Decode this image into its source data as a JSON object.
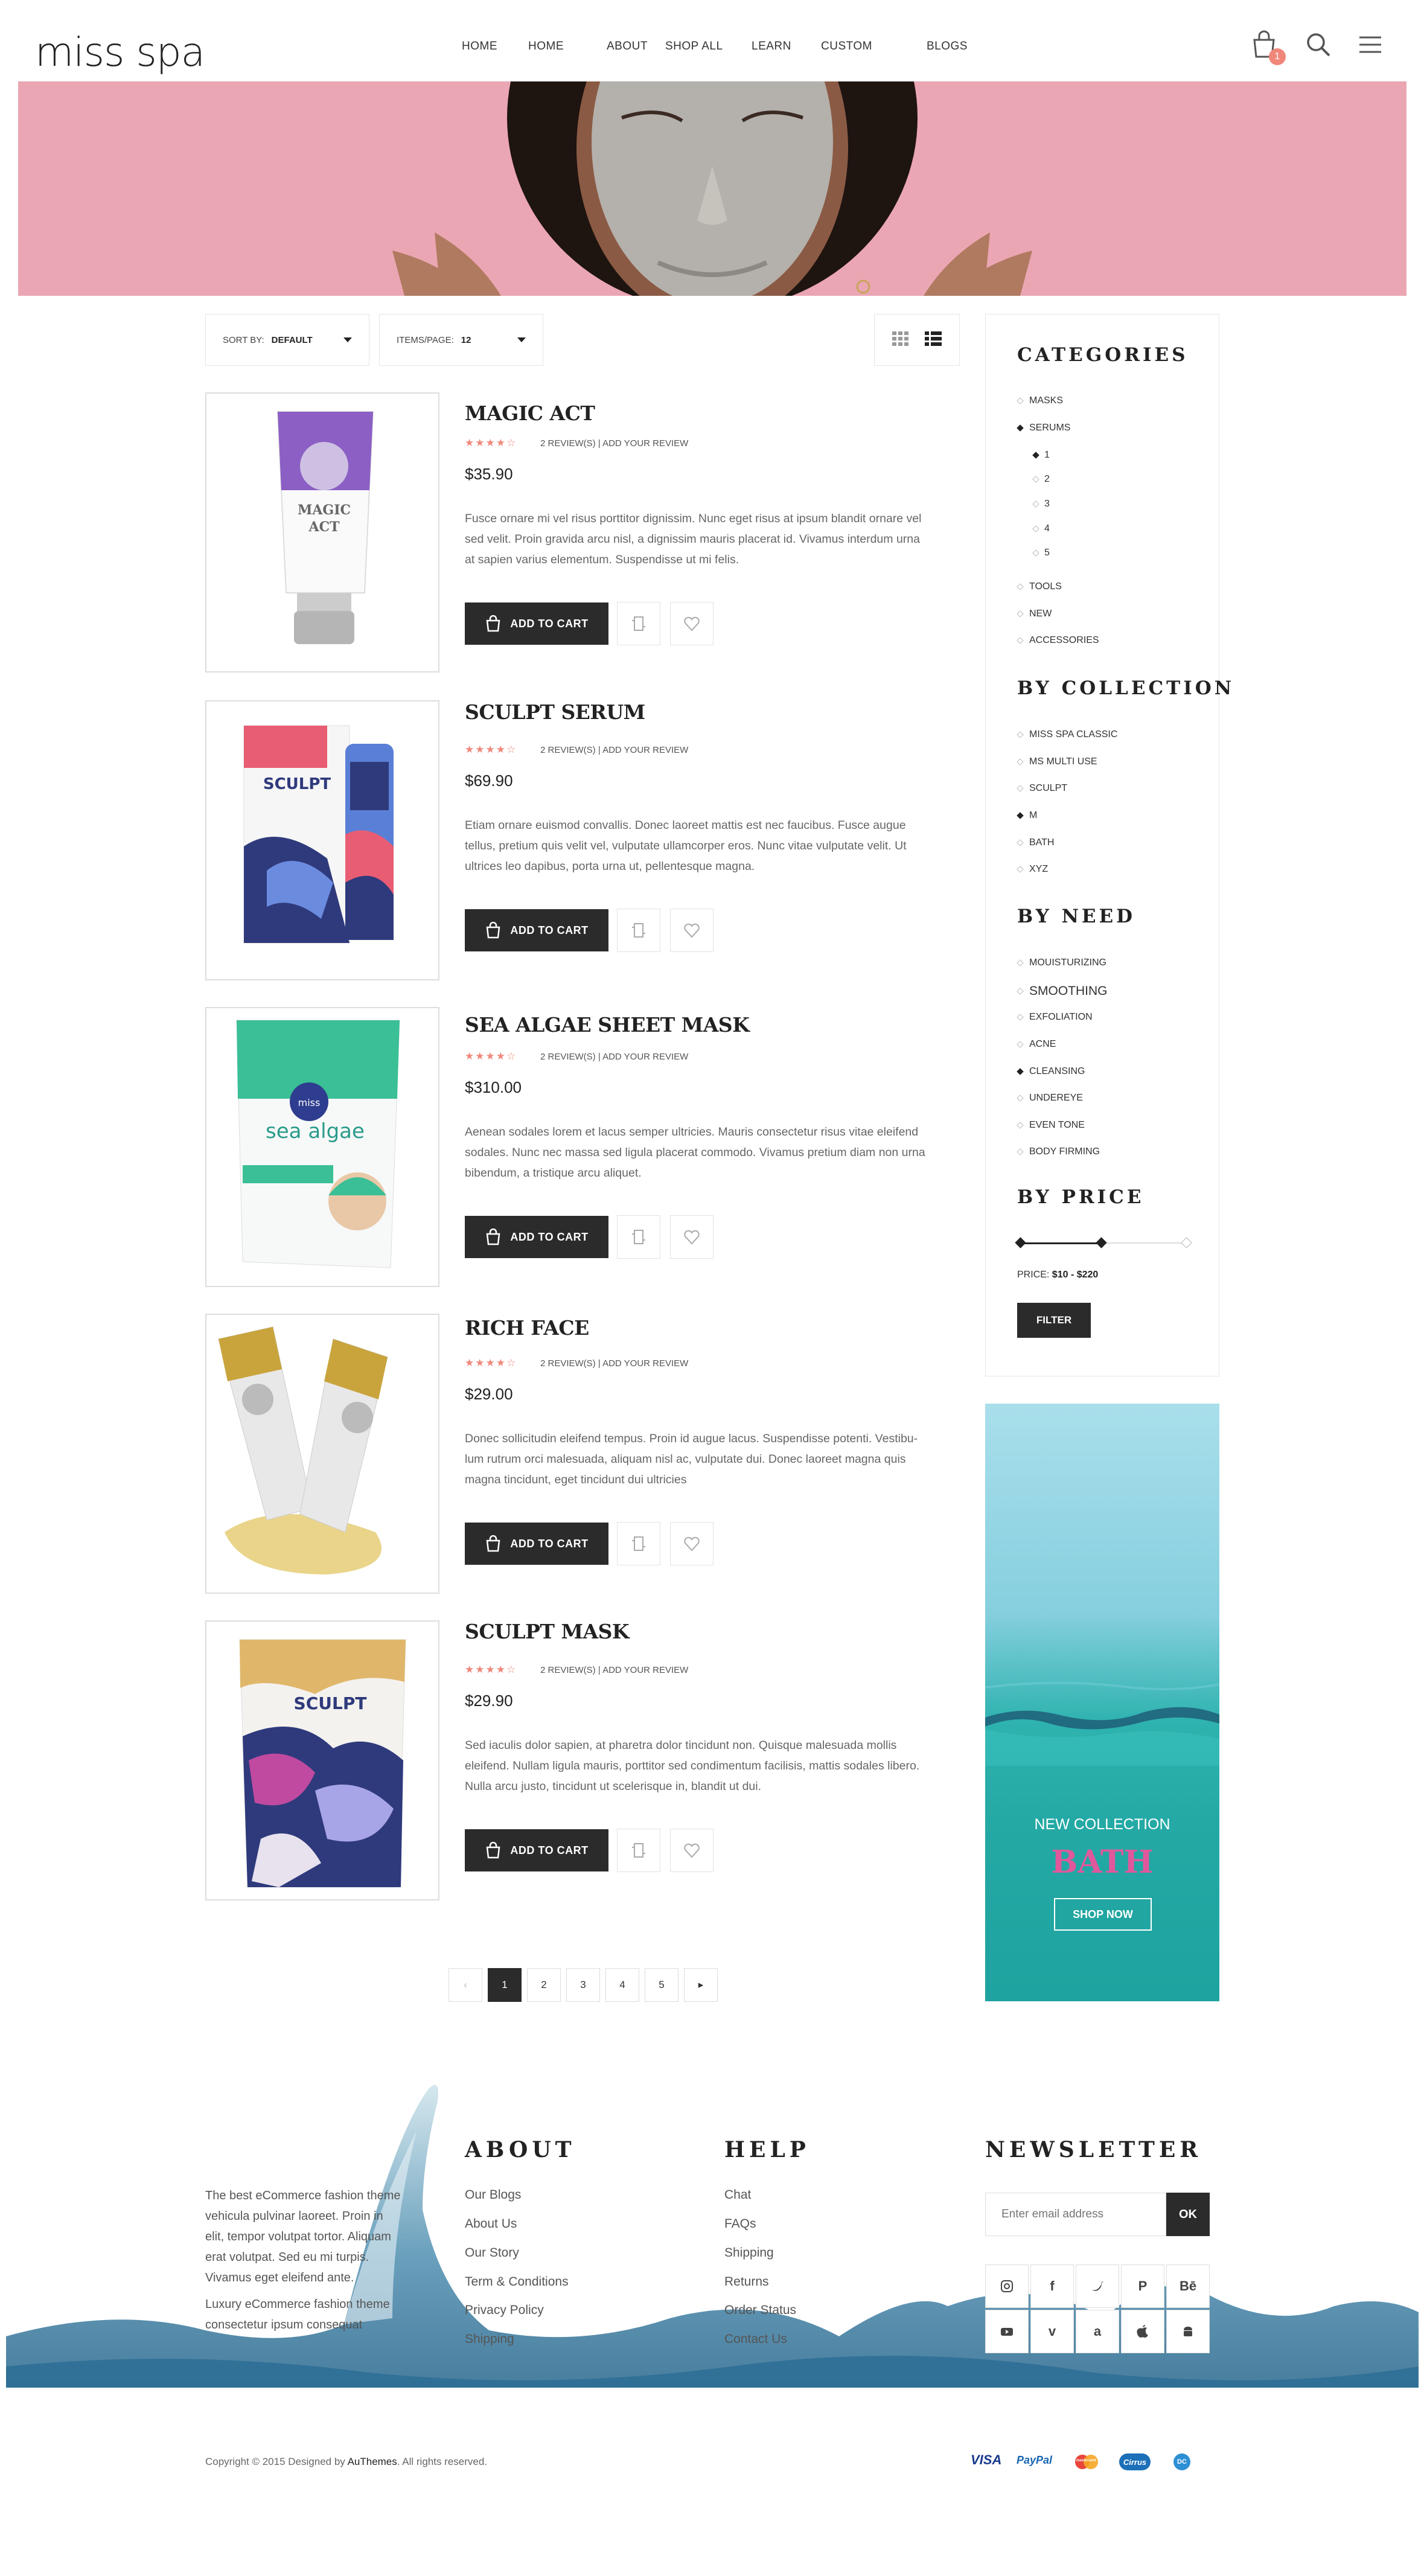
{
  "header": {
    "logo": "miss spa",
    "nav": [
      "HOME",
      "HOME",
      "ABOUT",
      "SHOP ALL",
      "LEARN",
      "CUSTOM",
      "BLOGS"
    ],
    "cart_count": "1"
  },
  "toolbar": {
    "sort_label": "SORT BY:",
    "sort_value": "DEFAULT",
    "items_label": "ITEMS/PAGE:",
    "items_value": "12"
  },
  "products": [
    {
      "title": "MAGIC ACT",
      "reviews": "2 REVIEW(S) | ADD YOUR REVIEW",
      "price": "$35.90",
      "rating": 4,
      "desc": [
        "Fusce ornare mi vel risus porttitor dignissim. Nunc eget risus at ipsum blandit ornare vel",
        "sed velit. Proin gravida arcu nisl, a dignissim mauris placerat id. Vivamus interdum urna",
        "at sapien varius elementum. Suspendisse ut mi felis."
      ],
      "add_to_cart": "ADD TO CART"
    },
    {
      "title": "SCULPT SERUM",
      "reviews": "2 REVIEW(S) | ADD YOUR REVIEW",
      "price": "$69.90",
      "rating": 4,
      "desc": [
        "Etiam ornare euismod convallis. Donec laoreet mattis est nec faucibus. Fusce augue",
        "tellus, pretium quis velit vel, vulputate ullamcorper eros. Nunc vitae vulputate velit. Ut",
        "ultrices leo dapibus, porta urna ut, pellentesque magna."
      ],
      "add_to_cart": "ADD TO CART"
    },
    {
      "title": "SEA ALGAE SHEET MASK",
      "reviews": "2 REVIEW(S) | ADD YOUR REVIEW",
      "price": "$310.00",
      "rating": 4,
      "desc": [
        "Aenean sodales lorem et lacus semper ultricies. Mauris consectetur risus vitae eleifend",
        "sodales. Nunc nec massa sed ligula placerat commodo. Vivamus pretium diam non urna",
        "bibendum, a tristique arcu aliquet."
      ],
      "add_to_cart": "ADD TO CART"
    },
    {
      "title": "RICH FACE",
      "reviews": "2 REVIEW(S) | ADD YOUR REVIEW",
      "price": "$29.00",
      "rating": 4,
      "desc": [
        "Donec sollicitudin eleifend tempus. Proin id augue lacus. Suspendisse potenti. Vestibu-",
        "lum rutrum orci malesuada, aliquam nisl ac, vulputate dui. Donec laoreet magna quis",
        "magna tincidunt, eget tincidunt dui ultricies"
      ],
      "add_to_cart": "ADD TO CART"
    },
    {
      "title": "SCULPT MASK",
      "reviews": "2 REVIEW(S) | ADD YOUR REVIEW",
      "price": "$29.90",
      "rating": 4,
      "desc": [
        "Sed iaculis dolor sapien, at pharetra dolor tincidunt non. Quisque malesuada mollis",
        "eleifend. Nullam ligula mauris, porttitor sed condimentum facilisis, mattis sodales libero.",
        "Nulla arcu justo, tincidunt ut scelerisque in, blandit ut dui."
      ],
      "add_to_cart": "ADD TO CART"
    }
  ],
  "pagination": [
    "1",
    "2",
    "3",
    "4",
    "5"
  ],
  "sidebar": {
    "categories_title": "CATEGORIES",
    "categories": [
      "MASKS",
      "SERUMS",
      "1",
      "2",
      "3",
      "4",
      "5",
      "TOOLS",
      "NEW",
      "ACCESSORIES"
    ],
    "collection_title": "BY COLLECTION",
    "collections": [
      "MISS SPA CLASSIC",
      "MS MULTI USE",
      "SCULPT",
      "M",
      "BATH",
      "XYZ"
    ],
    "need_title": "BY NEED",
    "needs": [
      "MOUISTURIZING",
      "SMOOTHING",
      "EXFOLIATION",
      "ACNE",
      "CLEANSING",
      "UNDEREYE",
      "EVEN TONE",
      "BODY FIRMING"
    ],
    "price_title": "BY PRICE",
    "price_label": "PRICE:",
    "price_range": "$10 - $220",
    "filter_button": "FILTER"
  },
  "banner": {
    "kicker": "NEW COLLECTION",
    "title": "BATH",
    "button": "SHOP NOW"
  },
  "footer": {
    "intro": [
      "The best eCommerce fashion theme",
      "vehicula pulvinar laoreet. Proin in",
      "elit, tempor volutpat tortor. Aliquam",
      "erat volutpat. Sed eu mi turpis.",
      "Vivamus eget eleifend ante.",
      "Luxury eCommerce fashion theme",
      "consectetur ipsum consequat"
    ],
    "about_title": "ABOUT",
    "about_links": [
      "Our Blogs",
      "About Us",
      "Our Story",
      "Term & Conditions",
      "Privacy Policy",
      "Shipping"
    ],
    "help_title": "HELP",
    "help_links": [
      "Chat",
      "FAQs",
      "Shipping",
      "Returns",
      "Order Status",
      "Contact Us"
    ],
    "newsletter_title": "NEWSLETTER",
    "email_placeholder": "Enter email address",
    "ok_button": "OK",
    "social_icons": [
      "instagram-icon",
      "facebook-icon",
      "twitter-icon",
      "pinterest-icon",
      "behance-icon",
      "youtube-icon",
      "vimeo-icon",
      "amazon-icon",
      "apple-icon",
      "android-icon"
    ],
    "copyright_pre": "Copyright © 2015 Designed by ",
    "copyright_brand": "AuThemes",
    "copyright_post": ". All rights reserved.",
    "payments": [
      "VISA",
      "PayPal",
      "mastercard",
      "Cirrus",
      "DC"
    ]
  },
  "colors": {
    "accent": "#f0877a",
    "dark": "#2b2b2b",
    "banner_title": "#e0589c",
    "hero_bg": "#eba6b3"
  }
}
